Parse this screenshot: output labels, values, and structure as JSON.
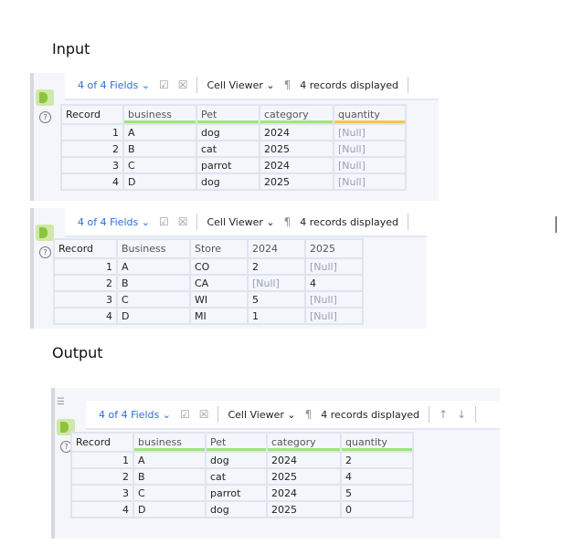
{
  "labels": {
    "input": "Input",
    "output": "Output"
  },
  "panels": [
    {
      "id": "input-1",
      "fields": "4 of 4 Fields",
      "viewer": "Cell Viewer",
      "records": "4 records displayed",
      "headers": [
        "Record",
        "business",
        "Pet",
        "category",
        "quantity"
      ],
      "underline": [
        "",
        "g",
        "g",
        "g",
        "y"
      ],
      "rows": [
        [
          "1",
          "A",
          "dog",
          "2024",
          "[Null]"
        ],
        [
          "2",
          "B",
          "cat",
          "2025",
          "[Null]"
        ],
        [
          "3",
          "C",
          "parrot",
          "2024",
          "[Null]"
        ],
        [
          "4",
          "D",
          "dog",
          "2025",
          "[Null]"
        ]
      ]
    },
    {
      "id": "input-2",
      "fields": "4 of 4 Fields",
      "viewer": "Cell Viewer",
      "records": "4 records displayed",
      "headers": [
        "Record",
        "Business",
        "Store",
        "2024",
        "2025"
      ],
      "underline": [
        "",
        "",
        "",
        "",
        ""
      ],
      "rows": [
        [
          "1",
          "A",
          "CO",
          "2",
          "[Null]"
        ],
        [
          "2",
          "B",
          "CA",
          "[Null]",
          "4"
        ],
        [
          "3",
          "C",
          "WI",
          "5",
          "[Null]"
        ],
        [
          "4",
          "D",
          "MI",
          "1",
          "[Null]"
        ]
      ]
    },
    {
      "id": "output",
      "fields": "4 of 4 Fields",
      "viewer": "Cell Viewer",
      "records": "4 records displayed",
      "headers": [
        "Record",
        "business",
        "Pet",
        "category",
        "quantity"
      ],
      "underline": [
        "",
        "g",
        "g",
        "g",
        "g"
      ],
      "rows": [
        [
          "1",
          "A",
          "dog",
          "2024",
          "2"
        ],
        [
          "2",
          "B",
          "cat",
          "2025",
          "4"
        ],
        [
          "3",
          "C",
          "parrot",
          "2024",
          "5"
        ],
        [
          "4",
          "D",
          "dog",
          "2025",
          "0"
        ]
      ]
    }
  ]
}
